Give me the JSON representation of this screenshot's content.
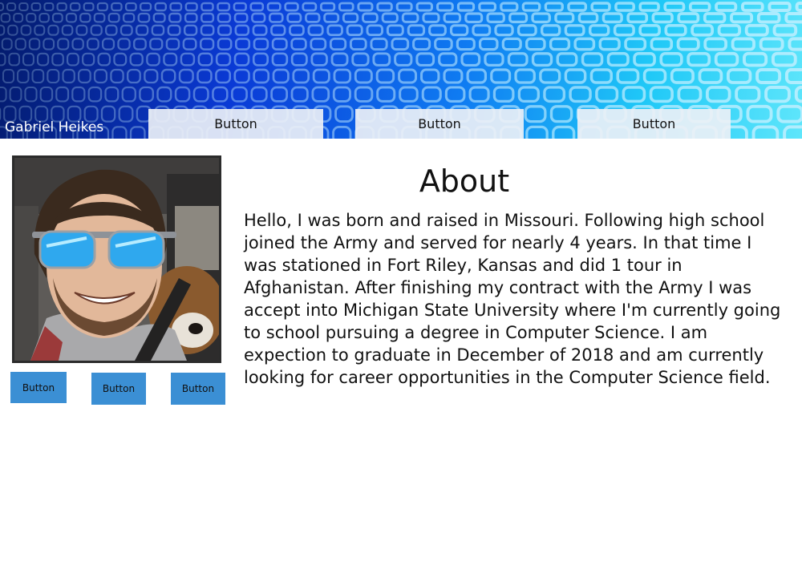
{
  "header": {
    "site_title": "Gabriel Heikes",
    "nav_buttons": [
      "Button",
      "Button",
      "Button"
    ],
    "background_colors": [
      "#031a6b",
      "#0a3ad6",
      "#1fc8f7"
    ]
  },
  "profile": {
    "photo_icon": "profile-photo",
    "buttons": [
      "Button",
      "Button",
      "Button"
    ],
    "button_color": "#3b8fd4"
  },
  "about": {
    "heading": "About",
    "text": "Hello, I was born and raised in Missouri. Following high school joined the Army and served for nearly 4 years. In that time I was stationed in Fort Riley, Kansas and did 1 tour in Afghanistan. After finishing my contract with the Army I was accept into Michigan State University where I'm currently going to school pursuing a degree in Computer Science. I am expection to graduate in December of 2018 and am currently looking for career opportunities in the Computer Science field."
  }
}
